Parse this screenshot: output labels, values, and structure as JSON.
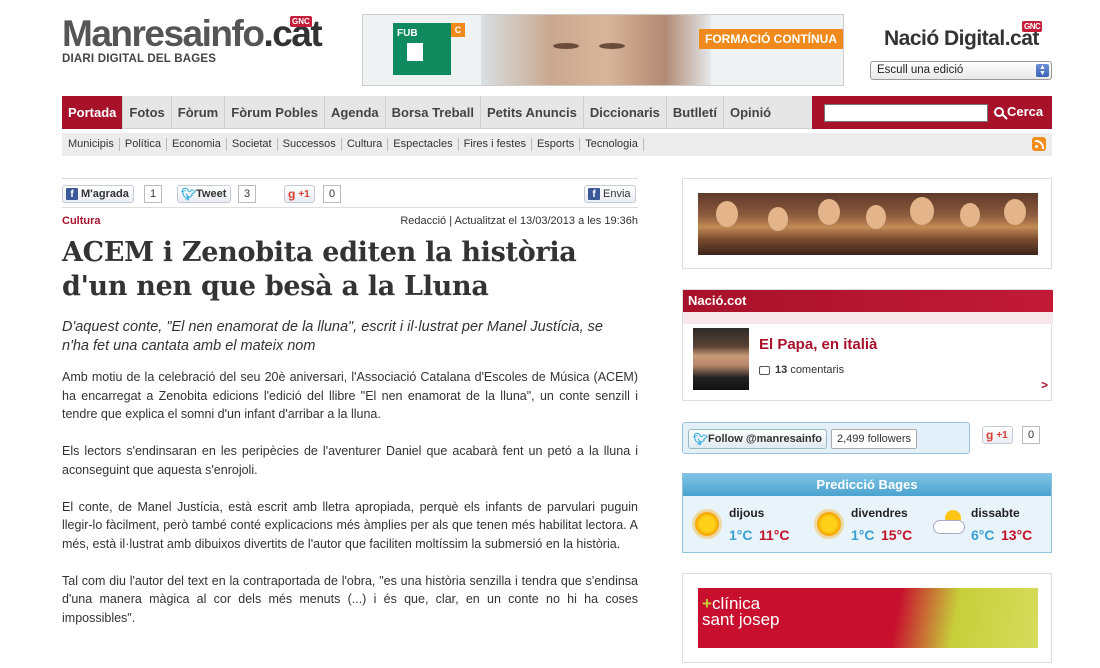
{
  "header": {
    "logo_main": "Manresainfo",
    "logo_ext": ".cat",
    "logo_badge": "GNC",
    "logo_tagline": "DIARI DIGITAL DEL BAGES",
    "banner_brand": "FUB",
    "banner_letter": "C",
    "banner_label": "FORMACIÓ CONTÍNUA",
    "nacio_logo": "Nació Digital",
    "nacio_ext": ".cat",
    "nacio_badge": "GNC",
    "edition_select": "Escull una edició"
  },
  "nav": {
    "items": [
      "Portada",
      "Fotos",
      "Fòrum",
      "Fòrum Pobles",
      "Agenda",
      "Borsa Treball",
      "Petits Anuncis",
      "Diccionaris",
      "Butlletí",
      "Opinió"
    ],
    "search_label": "Cerca",
    "search_placeholder": ""
  },
  "subnav": {
    "items": [
      "Municipis",
      "Política",
      "Economia",
      "Societat",
      "Successos",
      "Cultura",
      "Espectacles",
      "Fires i festes",
      "Esports",
      "Tecnologia"
    ]
  },
  "social": {
    "like_label": "M'agrada",
    "like_count": "1",
    "tweet_label": "Tweet",
    "tweet_count": "3",
    "gplus_label": "+1",
    "gplus_count": "0",
    "send_label": "Envia"
  },
  "article": {
    "category": "Cultura",
    "byline": "Redacció | Actualitzat el 13/03/2013 a les 19:36h",
    "title": "ACEM i Zenobita editen la història d'un nen que besà a la Lluna",
    "subtitle": "D'aquest conte, \"El nen enamorat de la lluna\", escrit i il·lustrat per Manel Justícia, se n'ha fet una cantata amb el mateix nom",
    "paragraphs": [
      "Amb motiu de la celebració del seu 20è aniversari, l'Associació Catalana d'Escoles de Música (ACEM) ha encarregat a Zenobita edicions l'edició del llibre \"El nen enamorat de la lluna\", un conte senzill i tendre que explica el somni d'un infant d'arribar a la lluna.",
      "Els lectors s'endinsaran en les peripècies de l'aventurer Daniel que acabarà fent un petó a la lluna i aconseguint que aquesta s'enrojoli.",
      "El conte, de Manel Justícia, està escrit amb lletra apropiada, perquè els infants de parvulari puguin llegir-lo fàcilment, però també conté explicacions més àmplies per als que tenen més habilitat lectora. A més, està il·lustrat amb dibuixos divertits de l'autor que faciliten moltíssim la submersió en la història.",
      "Tal com diu l'autor del text en la contraportada de l'obra, \"es una història senzilla i tendra que s'endinsa d'una manera màgica al cor dels més menuts (...) i és que, clar, en un conte no hi ha coses impossibles\"."
    ]
  },
  "sidebar": {
    "naciocot_header": "Nació.cot",
    "naciocot_title": "El Papa, en italià",
    "naciocot_comments_num": "13",
    "naciocot_comments_label": "comentaris",
    "naciocot_more": ">",
    "follow_label": "Follow @manresainfo",
    "followers": "2,499 followers",
    "gplus_label": "+1",
    "gplus_count": "0",
    "weather_title": "Predicció Bages",
    "weather": [
      {
        "day": "dijous",
        "min": "1°C",
        "max": "11°C",
        "icon": "sun-icon"
      },
      {
        "day": "divendres",
        "min": "1°C",
        "max": "15°C",
        "icon": "sun-icon"
      },
      {
        "day": "dissabte",
        "min": "6°C",
        "max": "13°C",
        "icon": "partly-cloudy-icon"
      }
    ],
    "clinica_line1": "clínica",
    "clinica_line2": "sant josep"
  },
  "colors": {
    "brand_red": "#a8112a",
    "nav_bg": "#e6e6e6",
    "weather_blue": "#4aa3d0"
  }
}
